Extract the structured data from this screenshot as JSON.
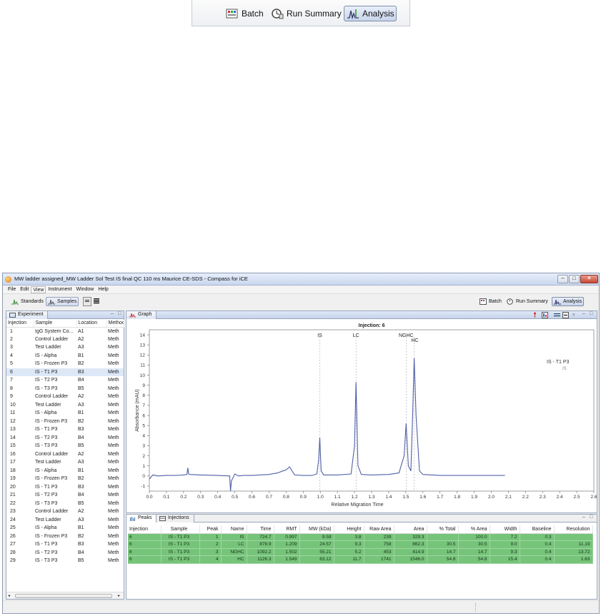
{
  "zoom_toolbar": {
    "batch": "Batch",
    "run_summary": "Run Summary",
    "analysis": "Analysis"
  },
  "window": {
    "title": "MW ladder assigned_MW Ladder Sol Test IS final QC 110 ms Maurice CE-SDS - Compass for iCE"
  },
  "menu": [
    "File",
    "Edit",
    "View",
    "Instrument",
    "Window",
    "Help"
  ],
  "toolbar": {
    "standards": "Standards",
    "samples": "Samples",
    "batch": "Batch",
    "run_summary": "Run Summary",
    "analysis": "Analysis"
  },
  "experiment": {
    "tab": "Experiment",
    "columns": [
      "Injection",
      "Sample",
      "Location",
      "Method"
    ],
    "rows": [
      [
        "1",
        "IgG System Co...",
        "A1",
        "Meth"
      ],
      [
        "2",
        "Control Ladder",
        "A2",
        "Meth"
      ],
      [
        "3",
        "Test Ladder",
        "A3",
        "Meth"
      ],
      [
        "4",
        "IS - Alpha",
        "B1",
        "Meth"
      ],
      [
        "5",
        "IS - Frozen P3",
        "B2",
        "Meth"
      ],
      [
        "6",
        "IS - T1 P3",
        "B3",
        "Meth"
      ],
      [
        "7",
        "IS - T2 P3",
        "B4",
        "Meth"
      ],
      [
        "8",
        "IS - T3 P3",
        "B5",
        "Meth"
      ],
      [
        "9",
        "Control Ladder",
        "A2",
        "Meth"
      ],
      [
        "10",
        "Test Ladder",
        "A3",
        "Meth"
      ],
      [
        "11",
        "IS - Alpha",
        "B1",
        "Meth"
      ],
      [
        "12",
        "IS - Frozen P3",
        "B2",
        "Meth"
      ],
      [
        "13",
        "IS - T1 P3",
        "B3",
        "Meth"
      ],
      [
        "14",
        "IS - T2 P3",
        "B4",
        "Meth"
      ],
      [
        "15",
        "IS - T3 P3",
        "B5",
        "Meth"
      ],
      [
        "16",
        "Control Ladder",
        "A2",
        "Meth"
      ],
      [
        "17",
        "Test Ladder",
        "A3",
        "Meth"
      ],
      [
        "18",
        "IS - Alpha",
        "B1",
        "Meth"
      ],
      [
        "19",
        "IS - Frozen P3",
        "B2",
        "Meth"
      ],
      [
        "20",
        "IS - T1 P3",
        "B3",
        "Meth"
      ],
      [
        "21",
        "IS - T2 P3",
        "B4",
        "Meth"
      ],
      [
        "22",
        "IS - T3 P3",
        "B5",
        "Meth"
      ],
      [
        "23",
        "Control Ladder",
        "A2",
        "Meth"
      ],
      [
        "24",
        "Test Ladder",
        "A3",
        "Meth"
      ],
      [
        "25",
        "IS - Alpha",
        "B1",
        "Meth"
      ],
      [
        "26",
        "IS - Frozen P3",
        "B2",
        "Meth"
      ],
      [
        "27",
        "IS - T1 P3",
        "B3",
        "Meth"
      ],
      [
        "28",
        "IS - T2 P3",
        "B4",
        "Meth"
      ],
      [
        "29",
        "IS - T3 P3",
        "B5",
        "Meth"
      ]
    ],
    "selected_index": 5
  },
  "graph": {
    "tab": "Graph",
    "title": "Injection: 6",
    "ylabel": "Absorbance (mAU)",
    "xlabel": "Relative Migration Time",
    "legend": {
      "sample": "IS - T1 P3",
      "marker": "IS"
    },
    "line_color": "#5060a8",
    "x_ticks": [
      "0.0",
      "0.1",
      "0.2",
      "0.3",
      "0.4",
      "0.5",
      "0.6",
      "0.7",
      "0.8",
      "0.9",
      "1.0",
      "1.1",
      "1.2",
      "1.3",
      "1.4",
      "1.5",
      "1.6",
      "1.7",
      "1.8",
      "1.9",
      "2.0",
      "2.1",
      "2.2",
      "2.3",
      "2.4",
      "2.5",
      "2.6"
    ],
    "y_ticks": [
      "14",
      "13",
      "12",
      "11",
      "10",
      "9",
      "8",
      "7",
      "6",
      "5",
      "4",
      "3",
      "2",
      "1",
      "0",
      "-1"
    ],
    "peak_labels": [
      {
        "label": "IS",
        "x": 0.997
      },
      {
        "label": "LC",
        "x": 1.209
      },
      {
        "label": "NGHC",
        "x": 1.502
      },
      {
        "label": "HC",
        "x": 1.549
      }
    ]
  },
  "chart_data": {
    "type": "line",
    "title": "Injection: 6",
    "xlabel": "Relative Migration Time",
    "ylabel": "Absorbance (mAU)",
    "xlim": [
      0,
      2.6
    ],
    "ylim": [
      -1.5,
      14.5
    ],
    "series": [
      {
        "name": "IS - T1 P3",
        "x": [
          0.0,
          0.02,
          0.05,
          0.1,
          0.15,
          0.2,
          0.22,
          0.225,
          0.23,
          0.235,
          0.3,
          0.4,
          0.47,
          0.475,
          0.48,
          0.5,
          0.52,
          0.55,
          0.6,
          0.7,
          0.75,
          0.78,
          0.8,
          0.82,
          0.85,
          0.9,
          0.95,
          0.98,
          0.99,
          0.997,
          1.005,
          1.02,
          1.1,
          1.18,
          1.2,
          1.209,
          1.22,
          1.24,
          1.3,
          1.4,
          1.46,
          1.49,
          1.502,
          1.515,
          1.53,
          1.54,
          1.549,
          1.56,
          1.58,
          1.6,
          1.7,
          1.8,
          2.0,
          2.08
        ],
        "y": [
          -0.3,
          0.1,
          0.0,
          0.05,
          0.05,
          0.1,
          0.15,
          0.8,
          0.2,
          0.15,
          0.1,
          0.05,
          0.0,
          -1.5,
          -0.5,
          0.2,
          0.0,
          0.05,
          0.05,
          0.15,
          0.3,
          0.5,
          0.6,
          0.9,
          0.1,
          0.05,
          0.05,
          0.2,
          1.5,
          3.8,
          0.5,
          0.1,
          0.1,
          0.2,
          3.0,
          9.3,
          1.0,
          0.15,
          0.1,
          0.15,
          0.3,
          2.0,
          5.2,
          1.0,
          0.5,
          6.0,
          11.7,
          6.0,
          0.5,
          0.15,
          0.05,
          0.05,
          0.05,
          0.05
        ]
      }
    ]
  },
  "peaks": {
    "tabs": [
      "Peaks",
      "Injections"
    ],
    "columns": [
      "Injection",
      "Sample",
      "Peak",
      "Name",
      "Time",
      "RMT",
      "MW (kDa)",
      "Height",
      "Raw Area",
      "Area",
      "% Total",
      "% Area",
      "Width",
      "Baseline",
      "Resolution"
    ],
    "rows": [
      [
        "6",
        "IS - T1 P3",
        "1",
        "IS",
        "724.7",
        "0.997",
        "9.59",
        "3.8",
        "239",
        "329.3",
        "",
        "100.0",
        "7.2",
        "0.3",
        ""
      ],
      [
        "6",
        "IS - T1 P3",
        "2",
        "LC",
        "878.9",
        "1.209",
        "24.57",
        "9.3",
        "758",
        "862.3",
        "30.5",
        "30.5",
        "9.0",
        "0.4",
        "11.19"
      ],
      [
        "6",
        "IS - T1 P3",
        "3",
        "NGHC",
        "1092.2",
        "1.502",
        "55.21",
        "5.2",
        "453",
        "414.9",
        "14.7",
        "14.7",
        "9.3",
        "0.4",
        "13.72"
      ],
      [
        "6",
        "IS - T1 P3",
        "4",
        "HC",
        "1126.3",
        "1.549",
        "63.12",
        "11.7",
        "1741",
        "1546.0",
        "54.8",
        "54.8",
        "15.4",
        "0.4",
        "1.63"
      ]
    ]
  }
}
